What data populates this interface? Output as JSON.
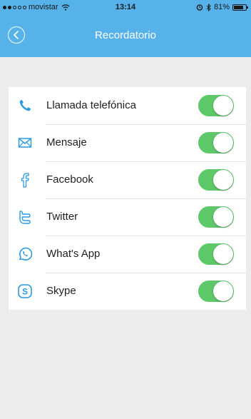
{
  "status_bar": {
    "carrier": "movistar",
    "time": "13:14",
    "battery": "81%",
    "battery_level": 0.81,
    "signal_bars": 2
  },
  "nav": {
    "title": "Recordatorio",
    "back_icon": "chevron-left-circle-icon"
  },
  "colors": {
    "header": "#56b2e9",
    "accent_icon": "#2b9ae0",
    "toggle_on": "#5cc867"
  },
  "settings": [
    {
      "label": "Llamada telefónica",
      "icon": "phone-icon",
      "on": true
    },
    {
      "label": "Mensaje",
      "icon": "mail-icon",
      "on": true
    },
    {
      "label": "Facebook",
      "icon": "facebook-icon",
      "on": true
    },
    {
      "label": "Twitter",
      "icon": "twitter-icon",
      "on": true
    },
    {
      "label": "What's App",
      "icon": "whatsapp-icon",
      "on": true
    },
    {
      "label": "Skype",
      "icon": "skype-icon",
      "on": true
    }
  ]
}
